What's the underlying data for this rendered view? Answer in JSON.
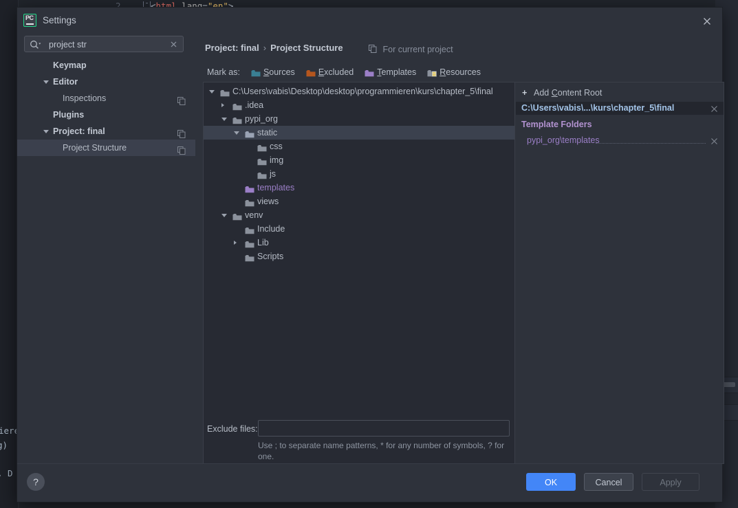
{
  "background": {
    "gutter_line_number": "2",
    "code_line": "<html lang=\"en\">",
    "left_fragments": [
      "ieren",
      "g)",
      ", D"
    ]
  },
  "dialog": {
    "logo": "pycharm-logo",
    "title": "Settings",
    "close_icon": "close-icon"
  },
  "search": {
    "icon": "search-icon",
    "value": "project str",
    "placeholder": "",
    "clear_icon": "clear-icon"
  },
  "sidebar": {
    "items": [
      {
        "label": "Keymap",
        "bold": true,
        "indent": 52,
        "arrow": "none",
        "copy": false
      },
      {
        "label": "Editor",
        "bold": true,
        "indent": 52,
        "arrow": "down",
        "copy": false
      },
      {
        "label": "Inspections",
        "bold": false,
        "indent": 66,
        "arrow": "none",
        "copy": true
      },
      {
        "label": "Plugins",
        "bold": true,
        "indent": 52,
        "arrow": "none",
        "copy": false
      },
      {
        "label": "Project: final",
        "bold": true,
        "indent": 52,
        "arrow": "down",
        "copy": true
      },
      {
        "label": "Project Structure",
        "bold": false,
        "indent": 66,
        "arrow": "none",
        "copy": true,
        "selected": true
      }
    ]
  },
  "header": {
    "breadcrumb_parent": "Project: final",
    "breadcrumb_separator": "›",
    "breadcrumb_current": "Project Structure",
    "scope_icon": "copy-icon",
    "scope_label": "For current project"
  },
  "mark_as": {
    "label": "Mark as:",
    "buttons": [
      {
        "label": "Sources",
        "mnemonic": "S",
        "color": "#3a7f93",
        "icon": "folder-sources-icon"
      },
      {
        "label": "Excluded",
        "mnemonic": "E",
        "color": "#b5561e",
        "icon": "folder-excluded-icon"
      },
      {
        "label": "Templates",
        "mnemonic": "T",
        "color": "#9b7fc7",
        "icon": "folder-templates-icon"
      },
      {
        "label": "Resources",
        "mnemonic": "R",
        "color": "#8b919c",
        "icon": "folder-resources-icon"
      }
    ]
  },
  "tree": {
    "rows": [
      {
        "label": "C:\\Users\\vabis\\Desktop\\desktop\\programmieren\\kurs\\chapter_5\\final",
        "depth": 0,
        "arrow": "down",
        "color": "#8b919c",
        "selected": false
      },
      {
        "label": ".idea",
        "depth": 1,
        "arrow": "right",
        "color": "#8b919c",
        "selected": false
      },
      {
        "label": "pypi_org",
        "depth": 1,
        "arrow": "down",
        "color": "#8b919c",
        "selected": false
      },
      {
        "label": "static",
        "depth": 2,
        "arrow": "down",
        "color": "#9aa3b4",
        "selected": true
      },
      {
        "label": "css",
        "depth": 3,
        "arrow": "none",
        "color": "#8b919c",
        "selected": false
      },
      {
        "label": "img",
        "depth": 3,
        "arrow": "none",
        "color": "#8b919c",
        "selected": false
      },
      {
        "label": "js",
        "depth": 3,
        "arrow": "none",
        "color": "#8b919c",
        "selected": false
      },
      {
        "label": "templates",
        "depth": 2,
        "arrow": "none",
        "color": "#9b7fc7",
        "selected": false
      },
      {
        "label": "views",
        "depth": 2,
        "arrow": "none",
        "color": "#8b919c",
        "selected": false
      },
      {
        "label": "venv",
        "depth": 1,
        "arrow": "down",
        "color": "#8b919c",
        "selected": false
      },
      {
        "label": "Include",
        "depth": 2,
        "arrow": "none",
        "color": "#8b919c",
        "selected": false
      },
      {
        "label": "Lib",
        "depth": 2,
        "arrow": "right",
        "color": "#8b919c",
        "selected": false
      },
      {
        "label": "Scripts",
        "depth": 2,
        "arrow": "none",
        "color": "#8b919c",
        "selected": false
      }
    ]
  },
  "exclude": {
    "label": "Exclude files:",
    "value": "",
    "placeholder": "",
    "hint": "Use ; to separate name patterns, * for any number of symbols, ? for one."
  },
  "right_panel": {
    "add_content_root": "Add Content Root",
    "add_content_root_mnemonic": "C",
    "add_icon": "plus-icon",
    "content_root_path": "C:\\Users\\vabis\\...\\kurs\\chapter_5\\final",
    "content_root_remove_icon": "remove-icon",
    "template_folders_title": "Template Folders",
    "template_folder_path": "pypi_org\\templates",
    "template_folder_remove_icon": "remove-icon"
  },
  "buttons": {
    "help": "?",
    "ok": "OK",
    "cancel": "Cancel",
    "apply": "Apply",
    "ok_color": "#4386f7"
  }
}
